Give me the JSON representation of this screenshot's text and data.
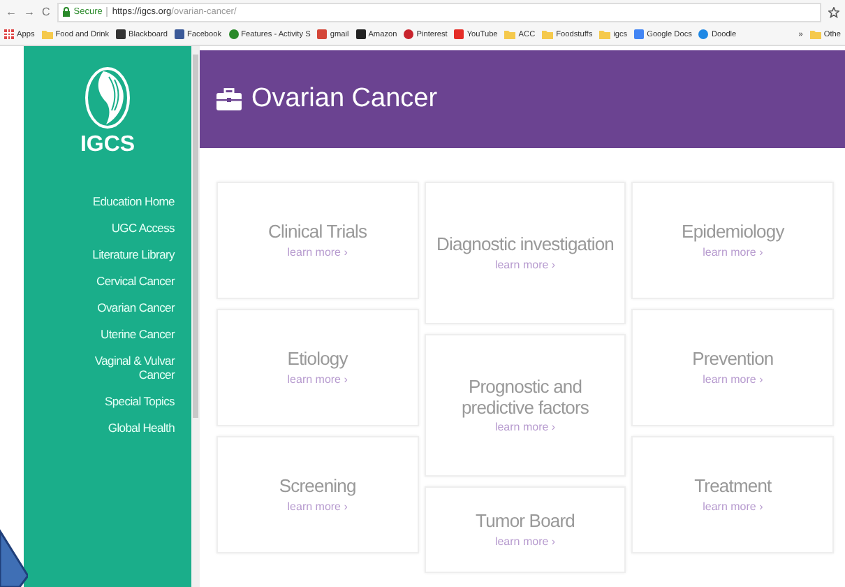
{
  "browser": {
    "nav": [
      "←",
      "→",
      "C"
    ],
    "secure": "Secure",
    "url_host": "https://igcs.org",
    "url_path": "/ovarian-cancer/",
    "bookmarks": [
      {
        "label": "Apps",
        "kind": "apps"
      },
      {
        "label": "Food and Drink",
        "kind": "folder"
      },
      {
        "label": "Blackboard",
        "kind": "square"
      },
      {
        "label": "Facebook",
        "kind": "facebook"
      },
      {
        "label": "Features - Activity S",
        "kind": "circle"
      },
      {
        "label": "gmail",
        "kind": "gmail"
      },
      {
        "label": "Amazon",
        "kind": "amazon"
      },
      {
        "label": "Pinterest",
        "kind": "pinterest"
      },
      {
        "label": "YouTube",
        "kind": "youtube"
      },
      {
        "label": "ACC",
        "kind": "folder"
      },
      {
        "label": "Foodstuffs",
        "kind": "folder"
      },
      {
        "label": "igcs",
        "kind": "folder"
      },
      {
        "label": "Google Docs",
        "kind": "docs"
      },
      {
        "label": "Doodle",
        "kind": "doodle"
      }
    ],
    "more": "»",
    "other": "Othe"
  },
  "sidebar": {
    "logo": "IGCS",
    "items": [
      {
        "label": "Education Home"
      },
      {
        "label": "UGC Access"
      },
      {
        "label": "Literature Library"
      },
      {
        "label": "Cervical Cancer"
      },
      {
        "label": "Ovarian Cancer"
      },
      {
        "label": "Uterine Cancer"
      },
      {
        "label": "Vaginal & Vulvar Cancer"
      },
      {
        "label": "Special Topics"
      },
      {
        "label": "Global Health"
      }
    ]
  },
  "header": {
    "title": "Ovarian Cancer"
  },
  "columns": [
    [
      {
        "title": "Clinical Trials",
        "link": "learn more ›"
      },
      {
        "title": "Etiology",
        "link": "learn more ›"
      },
      {
        "title": "Screening",
        "link": "learn more ›"
      }
    ],
    [
      {
        "title": "Diagnostic investigation",
        "link": "learn more ›"
      },
      {
        "title": "Prognostic and predictive factors",
        "link": "learn more ›"
      },
      {
        "title": "Tumor Board",
        "link": "learn more ›"
      }
    ],
    [
      {
        "title": "Epidemiology",
        "link": "learn more ›"
      },
      {
        "title": "Prevention",
        "link": "learn more ›"
      },
      {
        "title": "Treatment",
        "link": "learn more ›"
      }
    ]
  ]
}
